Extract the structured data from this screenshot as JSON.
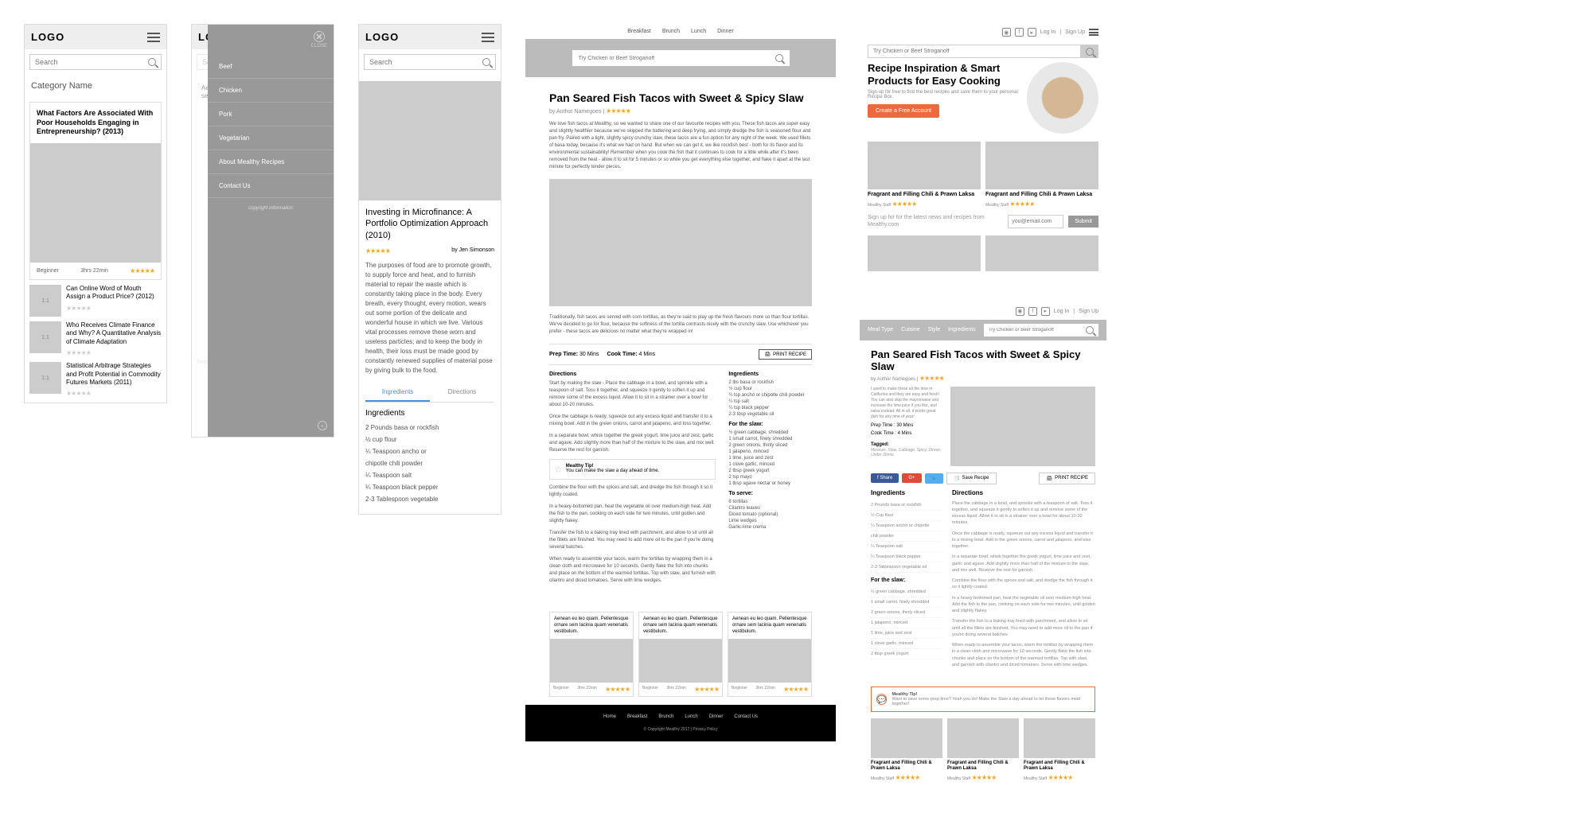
{
  "logo": "LOGO",
  "search_placeholder": "Search",
  "screen1": {
    "category": "Category Name",
    "featured": {
      "title": "What Factors Are Associated With Poor Households Engaging in Entrepreneurship? (2013)",
      "level": "Beginner",
      "time": "3hrs 22min"
    },
    "list": [
      {
        "thumb": "1:1",
        "title": "Can Online Word of Mouth Assign a Product Price? (2012)"
      },
      {
        "thumb": "1:1",
        "title": "Who Receives Climate Finance and Why? A Quantitative Analysis of Climate Adaptation"
      },
      {
        "thumb": "1:1",
        "title": "Statistical Arbitrage Strategies and Profit Potential in Commodity Futures Markets (2011)"
      }
    ]
  },
  "menu": {
    "close": "CLOSE",
    "items": [
      "Beef",
      "Chicken",
      "Pork",
      "Vegetarian",
      "About Mealthy Recipes",
      "Contact Us"
    ],
    "copyright": "copyright information"
  },
  "detail": {
    "title": "Investing in Microfinance: A Portfolio Optimization Approach (2010)",
    "author": "by Jen Simonson",
    "para": "The purposes of food are to promote growth, to supply force and heat, and to furnish material to repair the waste which is constantly taking place in the body. Every breath, every thought, every motion, wears out some portion of the delicate and wonderful house in which we live. Various vital processes remove these worn and useless particles; and to keep the body in health, their loss must be made good by constantly renewed supplies of material pose by giving bulk to the food.",
    "tabs": [
      "Ingredients",
      "Directions"
    ],
    "section": "Ingredients",
    "ingredients": [
      "2 Pounds basa or rockfish",
      "½ cup flour",
      "¼ Teaspoon ancho or",
      "chipotle chili powder",
      "¼ Teaspoon salt",
      "¼ Teaspoon black pepper",
      "2-3 Tablespoon vegetable"
    ]
  },
  "desktop1": {
    "topnav": [
      "Breakfast",
      "Brunch",
      "Lunch",
      "Dinner"
    ],
    "search_placeholder": "Try Chicken or Beef Stroganoff",
    "title": "Pan Seared Fish Tacos with Sweet & Spicy Slaw",
    "byline": "by Author Namegoes",
    "intro": "We love fish tacos at Mealthy, so we wanted to share one of our favourite recipes with you. These fish tacos are super easy and slightly healthier because we've skipped the battering and deep frying, and simply dredge the fish is seasoned flour and pan fry. Paired with a light, slightly spicy crunchy slaw, these tacos are a fun option for any night of the week. We used fillets of basa today, because it's what we had on hand. But when we can get it, we like rockfish best - both for its flavor and its environmental sustainability! Remember when you cook the fish that it continues to cook for a little while after it's been removed from the heat - allow it to sit for 5 minutes or so while you get everything else together, and flake it apart at the last minute for perfectly tender pieces.",
    "para2": "Traditionally, fish tacos are served with corn tortillas, as they're said to play up the fresh flavours more so than flour tortillas. We've decided to go for flour, because the softness of the tortilla contrasts nicely with the crunchy slaw. Use whichever you prefer - these tacos are delicious no matter what they're wrapped in!",
    "prep_label": "Prep Time:",
    "prep": "30 Mins",
    "cook_label": "Cook Time:",
    "cook": "4 Mins",
    "print": "PRINT RECIPE",
    "directions_label": "Directions",
    "directions": [
      "Start by making the slaw - Place the cabbage in a bowl, and sprinkle with a teaspoon of salt. Toss it together, and squeeze it gently to soften it up and remove some of the excess liquid. Allow it to sit in a strainer over a bowl for about 10-20 minutes.",
      "Once the cabbage is ready, squeeze out any excess liquid and transfer it to a mixing bowl. Add in the green onions, carrot and jalapeno, and toss together.",
      "In a separate bowl, whisk together the greek yogurt, lime juice and zest, garlic and agave. Add slightly more than half of the mixture to the slaw, and mix well. Reserve the rest for garnish.",
      "Combine the flour with the spices and salt, and dredge the fish through it so it lightly coated.",
      "In a heavy-bottomed pan, heat the vegetable oil over medium-high heat. Add the fish to the pan, cooking on each side for two minutes, until golden and slightly flakey.",
      "Transfer the fish to a baking tray lined with parchment, and allow to sit until all the fillets are finished. You may need to add more oil to the pan if you're doing several batches.",
      "When ready to assemble your tacos, warm the tortillas by wrapping them in a clean cloth and microwave for 10 seconds. Gently flake the fish into chunks and place on the bottom of the warmed tortillas. Top with slaw, and furnish with cilantro and diced tomatoes. Serve with lime wedges."
    ],
    "ingredients_label": "Ingredients",
    "ingredients": [
      "2 lbs basa or rockfish",
      "½ cup flour",
      "¼ tsp ancho or chipotle chili powder",
      "¼ tsp salt",
      "¼ tsp black pepper",
      "2-3 tbsp vegetable oil"
    ],
    "slaw_label": "For the slaw:",
    "slaw": [
      "½ green cabbage, shredded",
      "1 small carrot, finely shredded",
      "2 green onions, thinly sliced",
      "1 jalapeno, minced",
      "1 lime, juice and zest",
      "1 clove garlic, minced",
      "2 tbsp greek yogurt",
      "2 tsp mayo",
      "1 tbsp agave nectar or honey"
    ],
    "serve_label": "To serve:",
    "serve": [
      "8 tortillas",
      "Cilantro leaves",
      "Diced tomato (optional)",
      "Lime wedges",
      "Garlic-lime crema"
    ],
    "tip_label": "Mealthy Tip!",
    "tip_text": "You can make the slaw a day ahead of time.",
    "related": [
      {
        "title": "Aenean eu leo quam. Pellentesque ornare sem lacinia quam venenatis vestibulum.",
        "level": "Beginner",
        "time": "3hrs 22min"
      },
      {
        "title": "Aenean eu leo quam. Pellentesque ornare sem lacinia quam venenatis vestibulum.",
        "level": "Beginner",
        "time": "3hrs 22min"
      },
      {
        "title": "Aenean eu leo quam. Pellentesque ornare sem lacinia quam venenatis vestibulum.",
        "level": "Beginner",
        "time": "3hrs 22min"
      }
    ],
    "footer_nav": [
      "Home",
      "Breakfast",
      "Brunch",
      "Lunch",
      "Dinner",
      "Contact Us"
    ],
    "footer_copy": "© Copyright Mealthy 2017 | Privacy Policy"
  },
  "desktop2": {
    "login": "Log In",
    "signup_link": "Sign Up",
    "search_placeholder": "Try Chicken or Beef Stroganoff",
    "hero_title": "Recipe Inspiration & Smart Products for Easy Cooking",
    "hero_sub": "Sign up for free to find the best recipes and save them to your personal Recipe Box.",
    "cta": "Create a Free Account",
    "card_title": "Fragrant and Filling Chili & Prawn Laksa",
    "card_meta": "Mealthy Staff",
    "signup_text": "Sign up for for the latest news and recipes from Mealthy.com",
    "email_placeholder": "you@email.com",
    "submit": "Submit"
  },
  "desktop3": {
    "login": "Log In",
    "signup_link": "Sign Up",
    "nav": [
      "Meal Type",
      "Cuisine",
      "Style",
      "Ingredients"
    ],
    "search_placeholder": "Try Chicken or Beef Stroganoff",
    "title": "Pan Seared Fish Tacos with Sweet & Spicy Slaw",
    "byline": "by Author Namegoes",
    "sidebar_text": "I used to make these all the time in California and they are easy and fresh! You can also skip the mayonnaise and increase the lime juice if you like, and salsa instead. All in all, it works great dish for any time of year!",
    "prep": "Prep Time : 30 Mins",
    "cook": "Cook Time : 4 Mins",
    "tagged_label": "Tagged:",
    "tags": "Mexican, Slaw, Cabbage, Spicy, Dinner, Under 30min",
    "share": "Share",
    "save": "Save Recipe",
    "print": "PRINT RECIPE",
    "ingredients_label": "Ingredients",
    "ingredients": [
      "2 Pounds basa or rockfish",
      "½ Cup flour",
      "¼ Teaspoon ancho or chipotle",
      "chili powder",
      "¼ Teaspoon salt",
      "¼ Teaspoon black pepper",
      "2-3 Tablespoon vegetable oil"
    ],
    "slaw_label": "For the slaw:",
    "slaw": [
      "½ green cabbage, shredded",
      "1 small carrot, finely shredded",
      "2 green onions, thinly sliced",
      "1 jalapeno, minced",
      "1 lime, juice and zest",
      "1 clove garlic, minced",
      "2 tbsp greek yogurt"
    ],
    "directions_label": "Directions",
    "directions": [
      "Place the cabbage in a bowl, and sprinkle with a teaspoon of salt. Toss it together, and squeeze it gently to soften it up and remove some of the excess liquid. Allow it to sit in a strainer over a bowl for about 10-20 minutes.",
      "Once the cabbage is ready, squeeze out any excess liquid and transfer it to a mixing bowl. Add in the green onions, carrot and jalapeno, and toss together.",
      "In a separate bowl, whisk together the greek yogurt, lime juice and zest, garlic and agave. Add slightly more than half of the mixture to the slaw, and mix well. Reserve the rest for garnish.",
      "Combine the flour with the spices and salt, and dredge the fish through it so it lightly coated.",
      "In a heavy-bottomed pan, heat the vegetable oil over medium-high heat. Add the fish to the pan, cooking on each side for two minutes, until golden and slightly flakey.",
      "Transfer the fish to a baking tray lined with parchment, and allow to sit until all the fillets are finished. You may need to add more oil to the pan if you're doing several batches.",
      "When ready to assemble your tacos, warm the tortillas by wrapping them in a clean cloth and microwave for 10 seconds. Gently flake the fish into chunks and place on the bottom of the warmed tortillas. Top with slaw, and garnish with cilantro and diced tomatoes. Serve with lime wedges."
    ],
    "tip_label": "Mealthy Tip!",
    "tip_text": "Want to save some prep time? Yeah you do! Make the Slaw a day ahead to let those flavors meld together!",
    "related_title": "Fragrant and Filling Chili & Prawn Laksa",
    "related_meta": "Mealthy Staff"
  },
  "stars5": "★★★★★"
}
